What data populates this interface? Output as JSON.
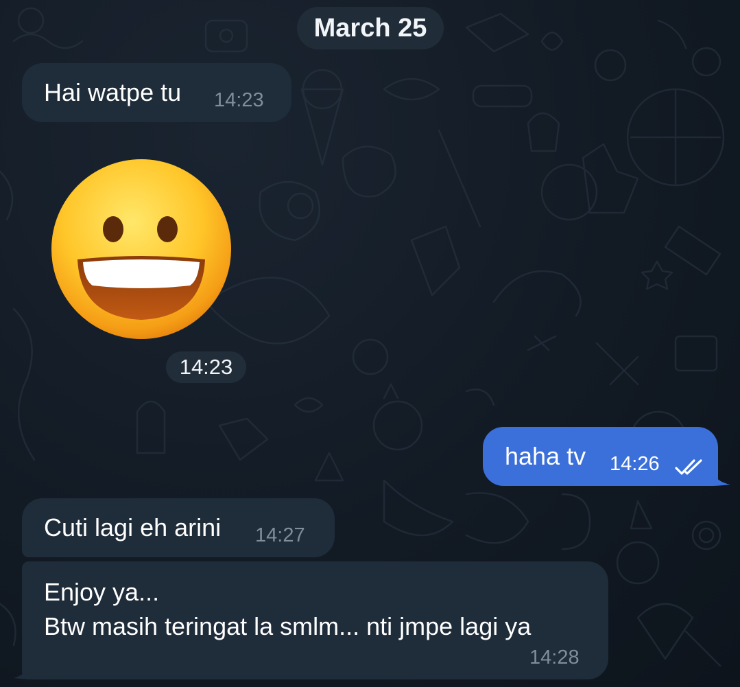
{
  "chat": {
    "date_separator": "March 25",
    "messages": [
      {
        "id": "m1",
        "direction": "incoming",
        "text": "Hai watpe tu",
        "time": "14:23"
      },
      {
        "id": "m2",
        "direction": "incoming",
        "type": "emoji",
        "emoji_icon": "grinning-face-with-big-eyes-icon",
        "time": "14:23"
      },
      {
        "id": "m3",
        "direction": "outgoing",
        "text": "haha tv",
        "time": "14:26",
        "status_icon": "double-check-icon"
      },
      {
        "id": "m4",
        "direction": "incoming",
        "text": "Cuti lagi eh arini",
        "time": "14:27"
      },
      {
        "id": "m5",
        "direction": "incoming",
        "lines": [
          "Enjoy ya...",
          "Btw masih teringat la smlm... nti jmpe lagi ya"
        ],
        "time": "14:28"
      }
    ]
  },
  "colors": {
    "background": "#0e1621",
    "incoming_bubble": "#1f2c3a",
    "outgoing_bubble": "#3b6fd9",
    "time_incoming": "#7f8e9b",
    "time_outgoing": "#ffffff"
  }
}
